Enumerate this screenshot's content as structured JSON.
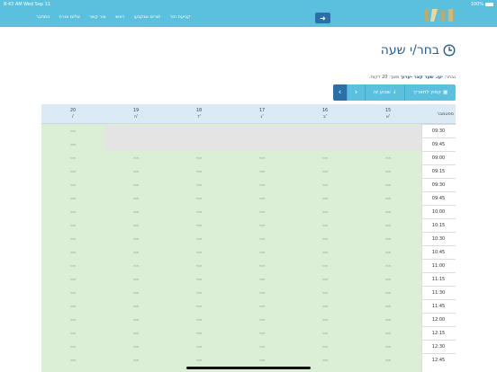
{
  "status_bar": {
    "time": "8:43 AM",
    "date": "Wed Sep 11",
    "battery": "100%"
  },
  "nav": {
    "links": [
      "קביעת תור",
      "תורים שנקבעו",
      "ראשי",
      "צור קשר",
      "שלום אורח",
      "התחבר"
    ],
    "toggle_icon": "arrow-right-icon"
  },
  "page": {
    "title": "בחר/י שעה",
    "icon": "clock-icon"
  },
  "info": {
    "prefix": "נבחר:",
    "service": "יעו. שער קצר -ערוך",
    "duration": "משך: 20 דקות."
  },
  "toolbar": {
    "jump_label": "קפוץ לתאריך",
    "this_week_label": "שבוע זה",
    "prev_icon": "chevron-left-icon",
    "next_icon": "chevron-right-icon"
  },
  "calendar": {
    "time_header": "ספטמבר",
    "days": [
      {
        "num": "15",
        "name": "א'"
      },
      {
        "num": "16",
        "name": "ב'"
      },
      {
        "num": "17",
        "name": "ג'"
      },
      {
        "num": "18",
        "name": "ד'"
      },
      {
        "num": "19",
        "name": "ה'"
      },
      {
        "num": "20",
        "name": "ו'"
      }
    ],
    "times": [
      "09:30",
      "09:45",
      "09:00",
      "09:15",
      "09:30",
      "09:45",
      "10:00",
      "10:15",
      "10:30",
      "10:45",
      "11:00",
      "11:15",
      "11:30",
      "11:45",
      "12:00",
      "12:15",
      "12:30",
      "12:45"
    ],
    "slot_label": "פנוי",
    "colors": {
      "available": "#dbeed6",
      "closed": "#e4e4e4",
      "header": "#dceaf5",
      "accent": "#5bc0de"
    }
  }
}
